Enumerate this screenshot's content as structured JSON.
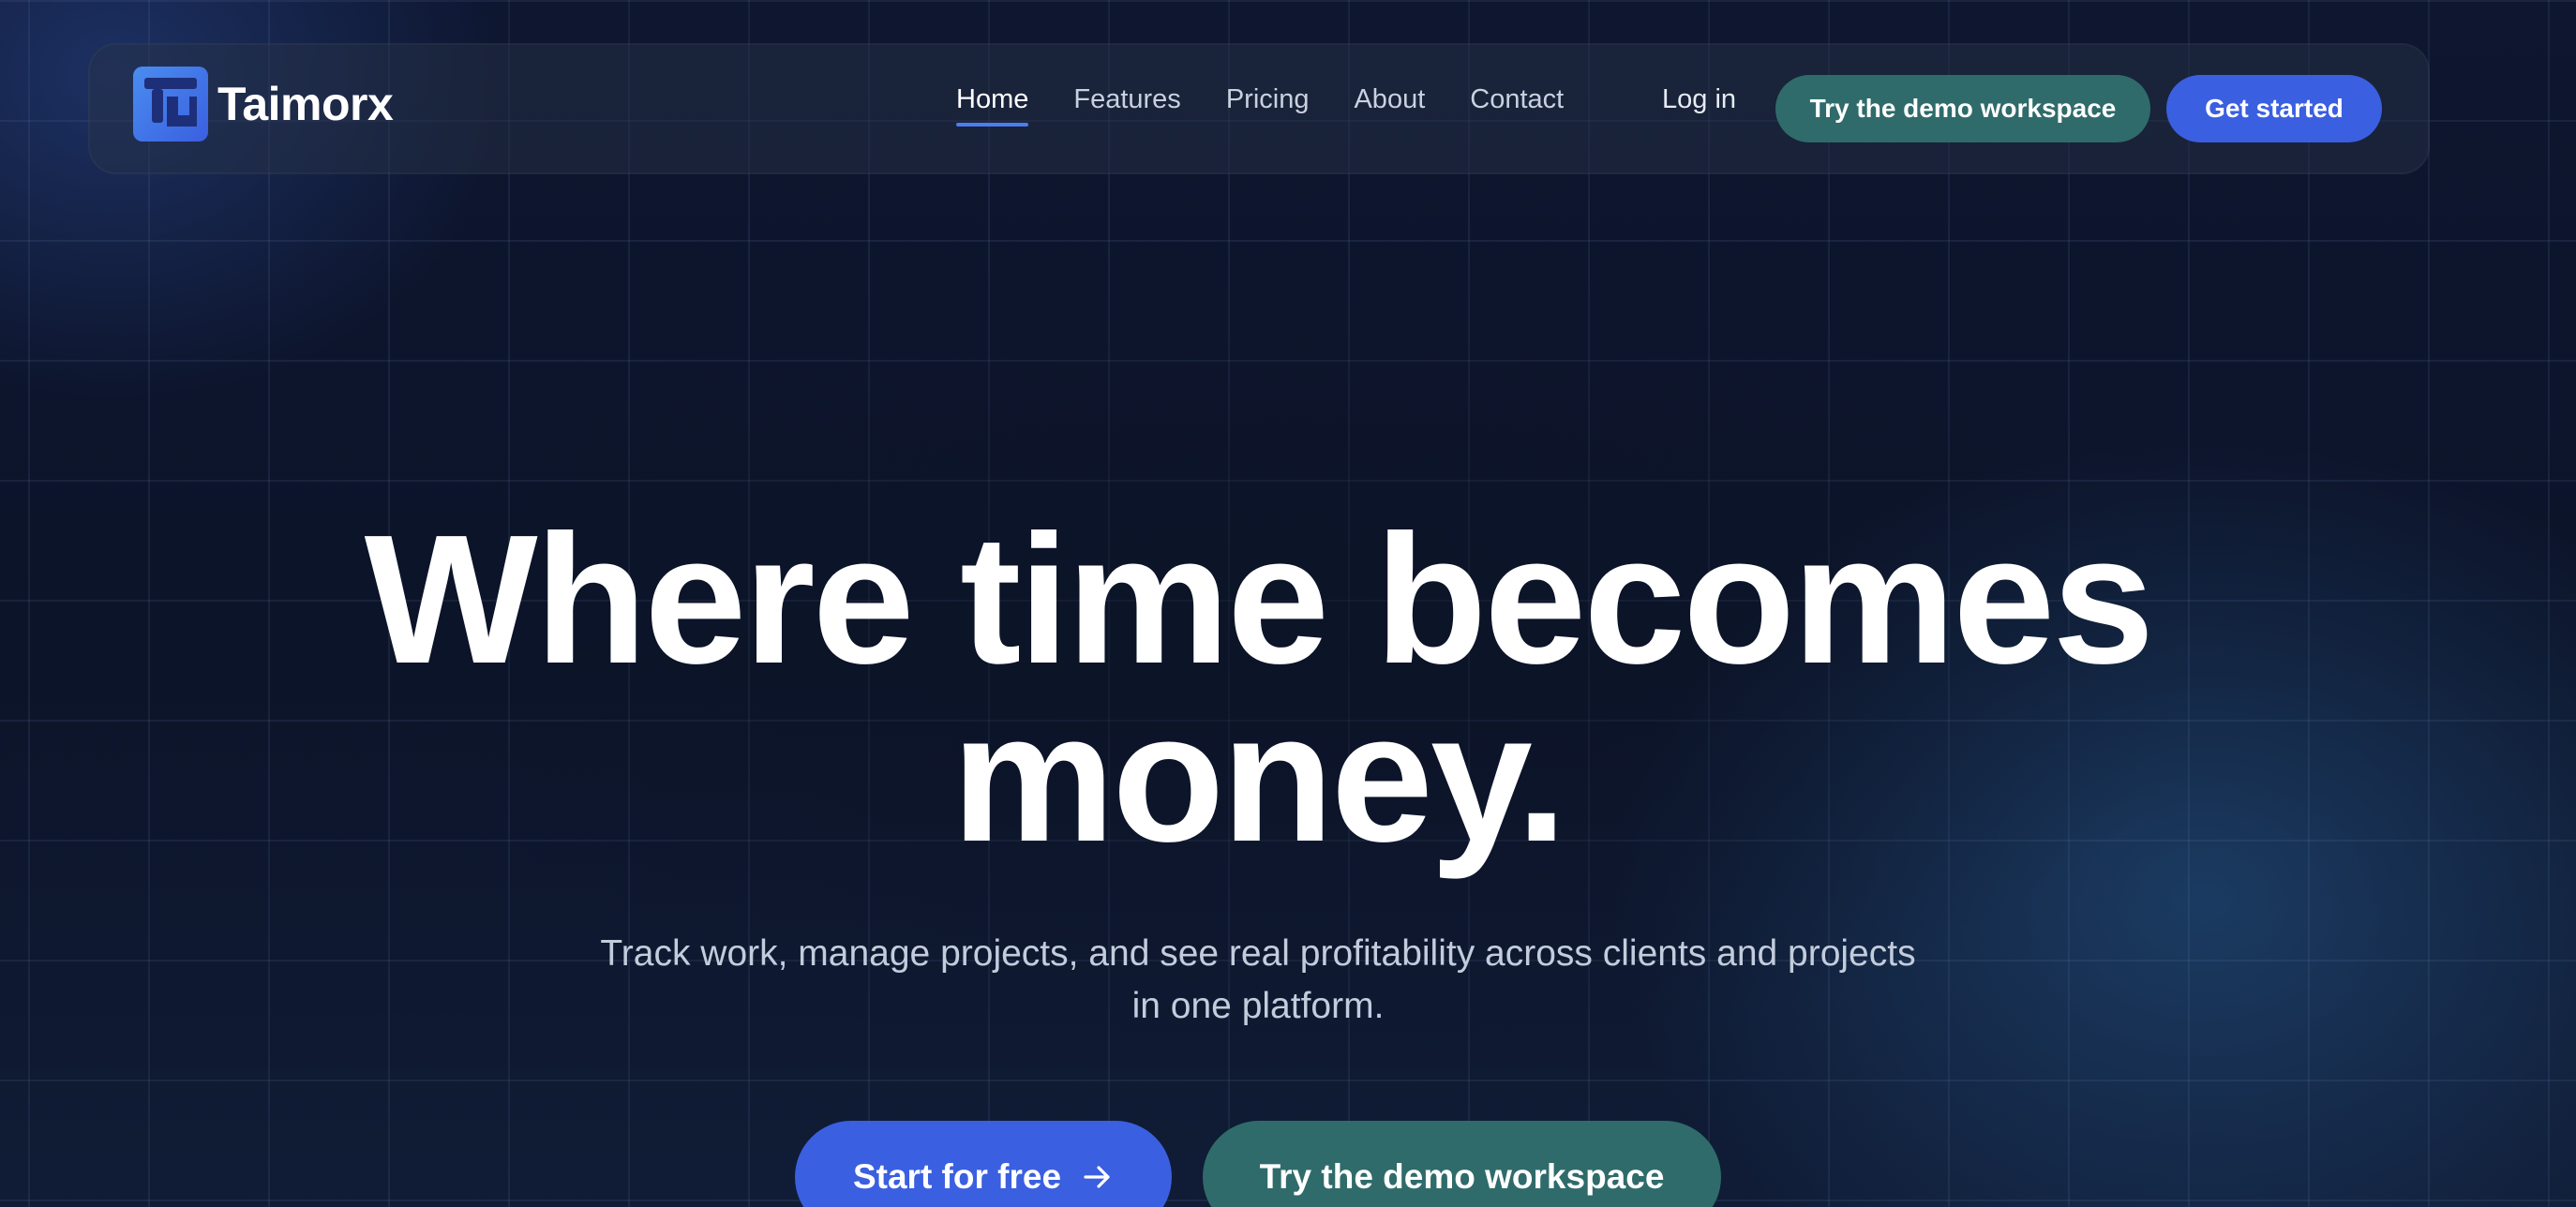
{
  "brand": {
    "name": "Taimorx",
    "logo_icon": "taimorx-logo-icon",
    "colors": {
      "logo_gradient_start": "#4a8df0",
      "logo_gradient_end": "#3a5fe0"
    }
  },
  "nav": {
    "links": [
      {
        "label": "Home",
        "active": true
      },
      {
        "label": "Features",
        "active": false
      },
      {
        "label": "Pricing",
        "active": false
      },
      {
        "label": "About",
        "active": false
      },
      {
        "label": "Contact",
        "active": false
      }
    ],
    "login_label": "Log in",
    "demo_label": "Try the demo workspace",
    "get_started_label": "Get started"
  },
  "hero": {
    "title_line1": "Where time becomes",
    "title_line2": "money.",
    "subtitle_line1": "Track work, manage projects, and see real profitability across clients and projects",
    "subtitle_line2": "in one platform.",
    "primary_cta_label": "Start for free",
    "primary_cta_icon": "arrow-right-icon",
    "secondary_cta_label": "Try the demo workspace"
  },
  "colors": {
    "background": "#0d1529",
    "primary": "#3a5fe0",
    "teal": "#2f6b6a",
    "active_underline": "#4b7cf0"
  }
}
